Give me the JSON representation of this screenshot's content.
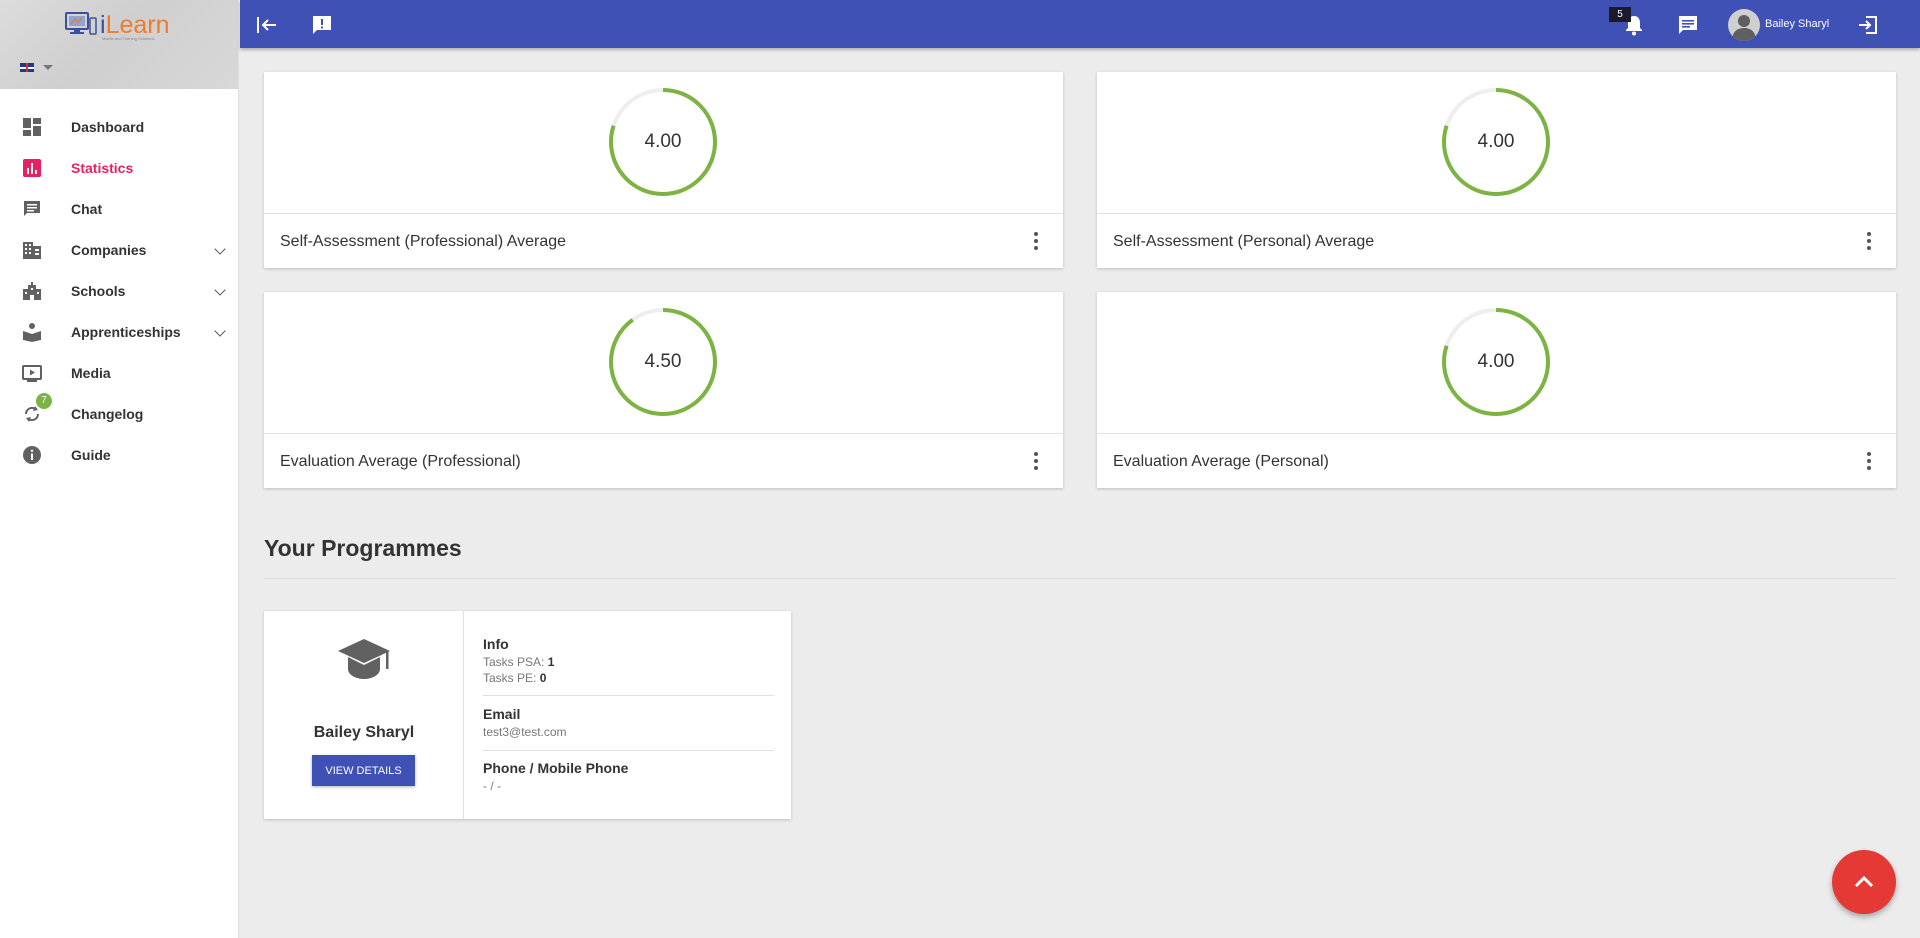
{
  "app": {
    "logo_i": "i",
    "logo_rest": "Learn",
    "logo_tagline": "Mobile and Training Solutions"
  },
  "sidebar": {
    "items": [
      {
        "label": "Dashboard",
        "icon": "dashboard-icon"
      },
      {
        "label": "Statistics",
        "icon": "bar-chart-icon",
        "active": true
      },
      {
        "label": "Chat",
        "icon": "chat-icon"
      },
      {
        "label": "Companies",
        "icon": "building-icon",
        "expandable": true
      },
      {
        "label": "Schools",
        "icon": "school-building-icon",
        "expandable": true
      },
      {
        "label": "Apprenticeships",
        "icon": "book-reader-icon",
        "expandable": true
      },
      {
        "label": "Media",
        "icon": "play-screen-icon"
      },
      {
        "label": "Changelog",
        "icon": "refresh-icon",
        "badge": "7"
      },
      {
        "label": "Guide",
        "icon": "info-icon"
      }
    ]
  },
  "topbar": {
    "notifications_count": "5",
    "user_name": "Bailey Sharyl"
  },
  "stats": [
    {
      "value": "4.00",
      "fraction": 0.8,
      "title": "Self-Assessment (Professional) Average"
    },
    {
      "value": "4.00",
      "fraction": 0.8,
      "title": "Self-Assessment (Personal) Average"
    },
    {
      "value": "4.50",
      "fraction": 0.9,
      "title": "Evaluation Average (Professional)"
    },
    {
      "value": "4.00",
      "fraction": 0.8,
      "title": "Evaluation Average (Personal)"
    }
  ],
  "programmes": {
    "title": "Your Programmes",
    "card": {
      "name": "Bailey Sharyl",
      "button_label": "VIEW DETAILS",
      "info_heading": "Info",
      "tasks_psa_label": "Tasks PSA:",
      "tasks_psa_value": "1",
      "tasks_pe_label": "Tasks PE:",
      "tasks_pe_value": "0",
      "email_heading": "Email",
      "email_value": "test3@test.com",
      "phone_heading": "Phone / Mobile Phone",
      "phone_value": "- / -"
    }
  },
  "colors": {
    "primary": "#3f51b5",
    "accent_active": "#e91e63",
    "ring_green": "#7cb342",
    "fab_red": "#e53935"
  }
}
